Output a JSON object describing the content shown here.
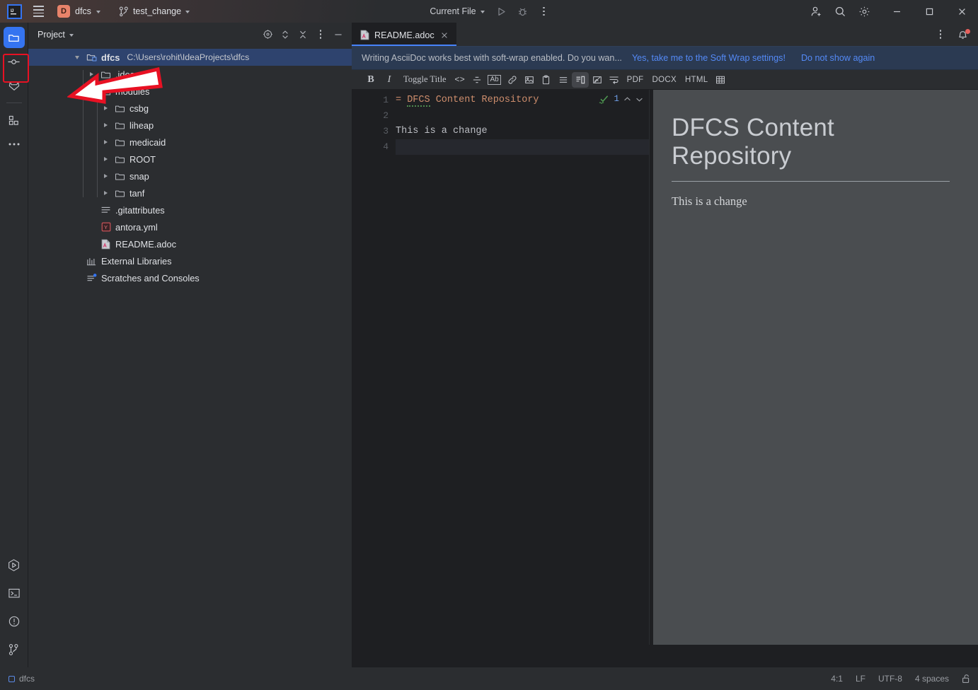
{
  "titlebar": {
    "logo": "IJ",
    "menu_icon": "hamburger-menu-icon",
    "project_badge": "D",
    "project_name": "dfcs",
    "branch_icon": "git-branch-icon",
    "branch_name": "test_change",
    "run_config": "Current File",
    "run_icon": "run-triangle-icon",
    "debug_icon": "debug-bug-icon",
    "more_icon": "more-vertical-icon",
    "account_icon": "account-add-icon",
    "search_icon": "search-icon",
    "settings_icon": "gear-icon",
    "minimize_icon": "minimize-icon",
    "maximize_icon": "maximize-icon",
    "close_icon": "close-icon"
  },
  "rail": {
    "top_items": [
      {
        "name": "project-tool-window",
        "icon": "folder-icon",
        "active": true
      },
      {
        "name": "commit-tool-window",
        "icon": "commit-node-icon",
        "active": false
      },
      {
        "name": "gitlab-tool-window",
        "icon": "gitlab-fox-icon",
        "active": false
      },
      {
        "name": "plugins-tool-window",
        "icon": "plugins-blocks-icon",
        "active": false
      },
      {
        "name": "more-tool-windows",
        "icon": "more-horizontal-icon",
        "active": false
      }
    ],
    "bottom_items": [
      {
        "name": "run-tool-window",
        "icon": "run-hex-icon"
      },
      {
        "name": "terminal-tool-window",
        "icon": "terminal-icon"
      },
      {
        "name": "problems-tool-window",
        "icon": "warning-circle-icon"
      },
      {
        "name": "version-control-tool-window",
        "icon": "git-branch-icon"
      }
    ]
  },
  "annotations": {
    "box_color": "#e81123",
    "arrow_color": "#e81123",
    "arrow_fill": "#ffffff"
  },
  "project_panel": {
    "title": "Project",
    "title_chevron": "chevron-down-icon",
    "actions": [
      {
        "name": "select-opened-file-button",
        "icon": "target-icon"
      },
      {
        "name": "expand-collapse-button",
        "icon": "expand-collapse-icon"
      },
      {
        "name": "collapse-all-button",
        "icon": "collapse-all-icon"
      },
      {
        "name": "options-button",
        "icon": "more-vertical-icon"
      },
      {
        "name": "hide-panel-button",
        "icon": "minimize-icon"
      }
    ],
    "tree": [
      {
        "id": "root",
        "label": "dfcs",
        "path": "C:\\Users\\rohit\\IdeaProjects\\dfcs",
        "indent": 0,
        "twisty": "down",
        "icon": "project-root-icon",
        "selected": true,
        "bold": true
      },
      {
        "id": "idea",
        "label": ".idea",
        "path": "",
        "indent": 1,
        "twisty": "right",
        "icon": "folder-icon",
        "selected": false,
        "bold": false
      },
      {
        "id": "modules",
        "label": "modules",
        "path": "",
        "indent": 1,
        "twisty": "down",
        "icon": "folder-icon",
        "selected": false,
        "bold": false
      },
      {
        "id": "csbg",
        "label": "csbg",
        "path": "",
        "indent": 2,
        "twisty": "right",
        "icon": "folder-icon",
        "selected": false,
        "bold": false
      },
      {
        "id": "liheap",
        "label": "liheap",
        "path": "",
        "indent": 2,
        "twisty": "right",
        "icon": "folder-icon",
        "selected": false,
        "bold": false
      },
      {
        "id": "medicaid",
        "label": "medicaid",
        "path": "",
        "indent": 2,
        "twisty": "right",
        "icon": "folder-icon",
        "selected": false,
        "bold": false
      },
      {
        "id": "root-mod",
        "label": "ROOT",
        "path": "",
        "indent": 2,
        "twisty": "right",
        "icon": "folder-icon",
        "selected": false,
        "bold": false
      },
      {
        "id": "snap",
        "label": "snap",
        "path": "",
        "indent": 2,
        "twisty": "right",
        "icon": "folder-icon",
        "selected": false,
        "bold": false
      },
      {
        "id": "tanf",
        "label": "tanf",
        "path": "",
        "indent": 2,
        "twisty": "right",
        "icon": "folder-icon",
        "selected": false,
        "bold": false
      },
      {
        "id": "gitattributes",
        "label": ".gitattributes",
        "path": "",
        "indent": 1,
        "twisty": "none",
        "icon": "text-file-icon",
        "selected": false,
        "bold": false
      },
      {
        "id": "antora",
        "label": "antora.yml",
        "path": "",
        "indent": 1,
        "twisty": "none",
        "icon": "yaml-file-icon",
        "selected": false,
        "bold": false
      },
      {
        "id": "readme",
        "label": "README.adoc",
        "path": "",
        "indent": 1,
        "twisty": "none",
        "icon": "adoc-file-icon",
        "selected": false,
        "bold": false
      },
      {
        "id": "extlibs",
        "label": "External Libraries",
        "path": "",
        "indent": 0,
        "twisty": "none",
        "icon": "library-icon",
        "selected": false,
        "bold": false
      },
      {
        "id": "scratches",
        "label": "Scratches and Consoles",
        "path": "",
        "indent": 0,
        "twisty": "none",
        "icon": "scratches-icon",
        "selected": false,
        "bold": false
      }
    ]
  },
  "editor": {
    "tab": {
      "name": "README.adoc",
      "icon": "adoc-file-icon",
      "close_icon": "close-icon"
    },
    "tab_options_icon": "more-vertical-icon",
    "notification_bell_icon": "notification-bell-icon",
    "notification": {
      "message": "Writing AsciiDoc works best with soft-wrap enabled. Do you wan...",
      "link_primary": "Yes, take me to the Soft Wrap settings!",
      "link_secondary": "Do not show again"
    },
    "toolbar": [
      {
        "name": "bold-button",
        "label": "B",
        "kind": "bold"
      },
      {
        "name": "italic-button",
        "label": "I",
        "kind": "italic"
      },
      {
        "name": "toggle-title-button",
        "label": "Toggle Title",
        "kind": "text"
      },
      {
        "name": "code-button",
        "label": "<>",
        "kind": "glyph"
      },
      {
        "name": "strikethrough-button",
        "label": "strikethrough-icon",
        "kind": "icon"
      },
      {
        "name": "attributes-button",
        "label": "Ab",
        "kind": "boxed"
      },
      {
        "name": "link-button",
        "label": "link-icon",
        "kind": "icon"
      },
      {
        "name": "image-button",
        "label": "image-icon",
        "kind": "icon"
      },
      {
        "name": "paste-button",
        "label": "clipboard-icon",
        "kind": "icon"
      },
      {
        "name": "list-button",
        "label": "list-icon",
        "kind": "icon"
      },
      {
        "name": "split-layout-button",
        "label": "split-editor-icon",
        "kind": "icon",
        "selected": true
      },
      {
        "name": "diagram-button",
        "label": "diagram-icon",
        "kind": "icon"
      },
      {
        "name": "soft-wrap-button",
        "label": "soft-wrap-icon",
        "kind": "icon"
      },
      {
        "name": "export-pdf-button",
        "label": "PDF",
        "kind": "mono"
      },
      {
        "name": "export-docx-button",
        "label": "DOCX",
        "kind": "mono"
      },
      {
        "name": "export-html-button",
        "label": "HTML",
        "kind": "mono"
      },
      {
        "name": "table-button",
        "label": "table-icon",
        "kind": "icon"
      }
    ],
    "code": {
      "lines": [
        {
          "no": "1",
          "marker": "=",
          "text": "DFCS Content Repository",
          "kind": "heading",
          "current": false
        },
        {
          "no": "2",
          "marker": "",
          "text": "",
          "kind": "blank",
          "current": false
        },
        {
          "no": "3",
          "marker": "",
          "text": "This is a change",
          "kind": "plain",
          "current": false
        },
        {
          "no": "4",
          "marker": "",
          "text": "",
          "kind": "blank",
          "current": true
        }
      ],
      "inspection_count": "1",
      "inspection_icon": "inspection-ok-icon",
      "prev_icon": "chevron-up-icon",
      "next_icon": "chevron-down-icon"
    },
    "preview": {
      "heading": "DFCS Content Repository",
      "paragraph": "This is a change"
    }
  },
  "statusbar": {
    "project_icon": "project-square-icon",
    "project": "dfcs",
    "caret": "4:1",
    "line_separator": "LF",
    "encoding": "UTF-8",
    "indent": "4 spaces",
    "lock_icon": "unlocked-padlock-icon"
  }
}
